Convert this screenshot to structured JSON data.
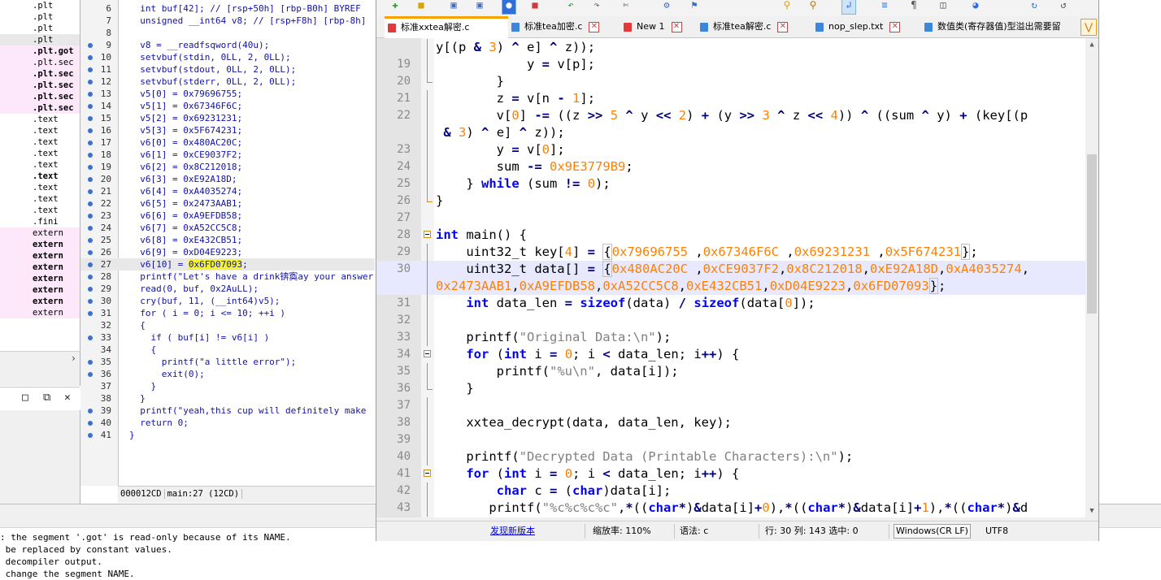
{
  "segments": [
    {
      "name": ".plt",
      "style": "plain"
    },
    {
      "name": ".plt",
      "style": "plain"
    },
    {
      "name": ".plt",
      "style": "plain"
    },
    {
      "name": ".plt",
      "style": "gray"
    },
    {
      "name": ".plt.got",
      "style": "pink-bold"
    },
    {
      "name": ".plt.sec",
      "style": "pink"
    },
    {
      "name": ".plt.sec",
      "style": "pink-bold"
    },
    {
      "name": ".plt.sec",
      "style": "pink-bold"
    },
    {
      "name": ".plt.sec",
      "style": "pink-bold"
    },
    {
      "name": ".plt.sec",
      "style": "pink-bold"
    },
    {
      "name": ".text",
      "style": "plain"
    },
    {
      "name": ".text",
      "style": "plain"
    },
    {
      "name": ".text",
      "style": "plain"
    },
    {
      "name": ".text",
      "style": "plain"
    },
    {
      "name": ".text",
      "style": "plain"
    },
    {
      "name": ".text",
      "style": "bold"
    },
    {
      "name": ".text",
      "style": "plain"
    },
    {
      "name": ".text",
      "style": "plain"
    },
    {
      "name": ".text",
      "style": "plain"
    },
    {
      "name": ".fini",
      "style": "plain"
    },
    {
      "name": "extern",
      "style": "pink"
    },
    {
      "name": "extern",
      "style": "pink-bold"
    },
    {
      "name": "extern",
      "style": "pink-bold"
    },
    {
      "name": "extern",
      "style": "pink-bold"
    },
    {
      "name": "extern",
      "style": "pink-bold"
    },
    {
      "name": "extern",
      "style": "pink-bold"
    },
    {
      "name": "extern",
      "style": "pink-bold"
    },
    {
      "name": "extern",
      "style": "pink"
    }
  ],
  "decompiler": {
    "lines": [
      {
        "n": "6",
        "dot": false,
        "text": "  int buf[42]; // [rsp+50h] [rbp-B0h] BYREF"
      },
      {
        "n": "7",
        "dot": false,
        "text": "  unsigned __int64 v8; // [rsp+F8h] [rbp-8h]"
      },
      {
        "n": "8",
        "dot": false,
        "text": ""
      },
      {
        "n": "9",
        "dot": true,
        "text": "  v8 = __readfsqword(40u);"
      },
      {
        "n": "10",
        "dot": true,
        "text": "  setvbuf(stdin, 0LL, 2, 0LL);"
      },
      {
        "n": "11",
        "dot": true,
        "text": "  setvbuf(stdout, 0LL, 2, 0LL);"
      },
      {
        "n": "12",
        "dot": true,
        "text": "  setvbuf(stderr, 0LL, 2, 0LL);"
      },
      {
        "n": "13",
        "dot": true,
        "text": "  v5[0] = 0x79696755;"
      },
      {
        "n": "14",
        "dot": true,
        "text": "  v5[1] = 0x67346F6C;"
      },
      {
        "n": "15",
        "dot": true,
        "text": "  v5[2] = 0x69231231;"
      },
      {
        "n": "16",
        "dot": true,
        "text": "  v5[3] = 0x5F674231;"
      },
      {
        "n": "17",
        "dot": true,
        "text": "  v6[0] = 0x480AC20C;"
      },
      {
        "n": "18",
        "dot": true,
        "text": "  v6[1] = 0xCE9037F2;"
      },
      {
        "n": "19",
        "dot": true,
        "text": "  v6[2] = 0x8C212018;"
      },
      {
        "n": "20",
        "dot": true,
        "text": "  v6[3] = 0xE92A18D;"
      },
      {
        "n": "21",
        "dot": true,
        "text": "  v6[4] = 0xA4035274;"
      },
      {
        "n": "22",
        "dot": true,
        "text": "  v6[5] = 0x2473AAB1;"
      },
      {
        "n": "23",
        "dot": true,
        "text": "  v6[6] = 0xA9EFDB58;"
      },
      {
        "n": "24",
        "dot": true,
        "text": "  v6[7] = 0xA52CC5C8;"
      },
      {
        "n": "25",
        "dot": true,
        "text": "  v6[8] = 0xE432CB51;"
      },
      {
        "n": "26",
        "dot": true,
        "text": "  v6[9] = 0xD04E9223;"
      },
      {
        "n": "27",
        "dot": true,
        "text": "  v6[10] = ",
        "yellow": "0x6FD07093",
        "after": ";",
        "hl": true
      },
      {
        "n": "28",
        "dot": true,
        "text": "  printf(\"Let's have a drink锛寏ay your answer"
      },
      {
        "n": "29",
        "dot": true,
        "text": "  read(0, buf, 0x2AuLL);"
      },
      {
        "n": "30",
        "dot": true,
        "text": "  cry(buf, 11, (__int64)v5);"
      },
      {
        "n": "31",
        "dot": true,
        "text": "  for ( i = 0; i <= 10; ++i )"
      },
      {
        "n": "32",
        "dot": false,
        "text": "  {"
      },
      {
        "n": "33",
        "dot": true,
        "text": "    if ( buf[i] != v6[i] )"
      },
      {
        "n": "34",
        "dot": false,
        "text": "    {"
      },
      {
        "n": "35",
        "dot": true,
        "text": "      printf(\"a little error\");"
      },
      {
        "n": "36",
        "dot": true,
        "text": "      exit(0);"
      },
      {
        "n": "37",
        "dot": false,
        "text": "    }"
      },
      {
        "n": "38",
        "dot": false,
        "text": "  }"
      },
      {
        "n": "39",
        "dot": true,
        "text": "  printf(\"yeah,this cup will definitely make"
      },
      {
        "n": "40",
        "dot": true,
        "text": "  return 0;"
      },
      {
        "n": "41",
        "dot": true,
        "text": "}"
      }
    ],
    "status_addr": "000012CD",
    "status_loc": "main:27 (12CD)"
  },
  "output": {
    "lines": [
      ": the segment '.got' is read-only because of its NAME.",
      " be replaced by constant values.",
      " decompiler output.",
      " change the segment NAME."
    ]
  },
  "notepad": {
    "tabs": [
      {
        "label": "标准xxtea解密.c",
        "color": "red",
        "active": true
      },
      {
        "label": "标准tea加密.c",
        "color": "blue",
        "active": false
      },
      {
        "label": "New 1",
        "color": "red",
        "active": false
      },
      {
        "label": "标准tea解密.c",
        "color": "blue",
        "active": false
      },
      {
        "label": "nop_slep.txt",
        "color": "blue",
        "active": false
      },
      {
        "label": "数值类(寄存器值)型溢出需要留",
        "color": "blue",
        "active": false
      }
    ],
    "line_numbers": [
      "",
      "19",
      "20",
      "21",
      "22",
      "",
      "23",
      "24",
      "25",
      "26",
      "27",
      "28",
      "29",
      "30",
      "",
      "31",
      "32",
      "33",
      "34",
      "35",
      "36",
      "37",
      "38",
      "39",
      "40",
      "41",
      "42",
      "43"
    ],
    "status": {
      "link": "发现新版本",
      "zoom": "缩放率: 110%",
      "lang": "语法: c",
      "pos": "行: 30 列: 143 选中: 0",
      "eol": "Windows(CR LF)",
      "enc": "UTF8"
    }
  },
  "colors": {
    "keyword": "#0000ff",
    "number": "#ff8000",
    "string": "#808080",
    "operator": "#000080",
    "active_tab_accent": "#f7a200",
    "current_line": "#e8e8ff",
    "ida_pink": "#fde7fb"
  }
}
